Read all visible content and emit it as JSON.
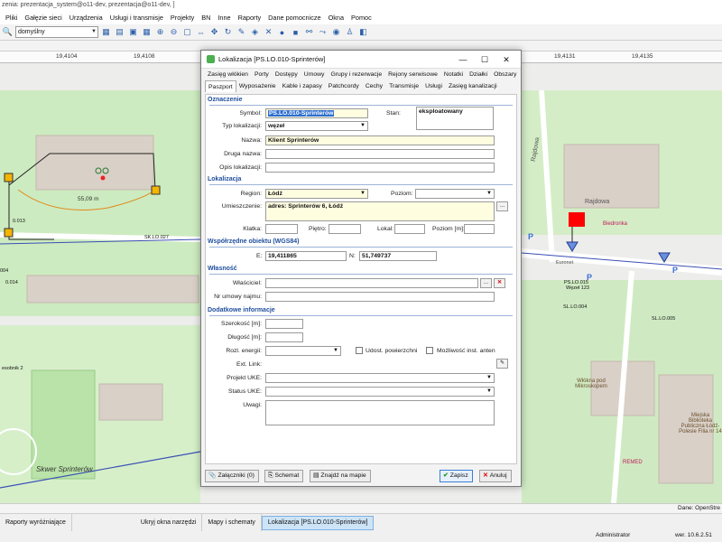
{
  "app": {
    "title": "zenia: prezentacja_system@o11-dev, prezentacja@o11-dev, ]",
    "menu": [
      "Pliki",
      "Gałęzie sieci",
      "Urządzenia",
      "Usługi i transmisje",
      "Projekty",
      "BN",
      "Inne",
      "Raporty",
      "Dane pomocnicze",
      "Okna",
      "Pomoc"
    ],
    "toolbar_combo": "domyślny"
  },
  "map": {
    "ruler_labels": [
      "19,4104",
      "19,4108",
      "19,4131",
      "19,4135"
    ],
    "labels": {
      "skwer": "Skwer Sprinterów",
      "street1": "Rajdowa",
      "street2": "Rajdowa",
      "biedronka": "Biedronka",
      "euronet": "Euronet",
      "wlokna": "Włókna pod Mikroskopem",
      "library": "Miejska Biblioteka Publiczna Łódź-Polesie Filia nr 14",
      "remed": "REMED",
      "distance": "55,09 m",
      "node_ps": "PS.LO.015",
      "node_wezel": "Węzeł 123",
      "node_sl1": "SL.LO.004",
      "node_sl2": "SL.LO.005",
      "node_sk": "SK.LO.027",
      "node_left1": "0.013",
      "node_left2": "004",
      "node_left3": "0.014",
      "left_pocz": "esobnik 2",
      "p": "P"
    }
  },
  "dialog": {
    "title": "Lokalizacja [PS.LO.010-Sprinterów]",
    "tabs_row1": [
      "Zasięg włókien",
      "Porty",
      "Dostępy",
      "Umowy",
      "Grupy i rezerwacje",
      "Rejony serwisowe",
      "Notatki",
      "Działki",
      "Obszary"
    ],
    "tabs_row2": [
      "Paszport",
      "Wyposażenie",
      "Kable i zapasy",
      "Patchcordy",
      "Cechy",
      "Transmisje",
      "Usługi",
      "Zasięg kanalizacji"
    ],
    "selected_tab": "Paszport",
    "sections": {
      "oznaczenie": "Oznaczenie",
      "lokalizacja": "Lokalizacja",
      "wspolrzedne": "Współrzędne obiektu (WGS84)",
      "wlasnosc": "Własność",
      "dodatkowe": "Dodatkowe informacje"
    },
    "fields": {
      "symbol_label": "Symbol:",
      "symbol_value": "PS.LO.010-Sprinterów",
      "stan_label": "Stan:",
      "stan_value": "eksploatowany",
      "typ_label": "Typ lokalizacji:",
      "typ_value": "węzeł",
      "nazwa_label": "Nazwa:",
      "nazwa_value": "Klient Sprinterów",
      "druga_label": "Druga nazwa:",
      "druga_value": "",
      "opis_label": "Opis lokalizacji:",
      "opis_value": "",
      "region_label": "Region:",
      "region_value": "Łódź",
      "poziom_label": "Poziom:",
      "poziom_value": "",
      "umiejsc_label": "Umieszczenie:",
      "umiejsc_value": "adres: Sprinterów 6, Łódź",
      "klatka_label": "Klatka:",
      "pietro_label": "Piętro:",
      "lokal_label": "Lokal:",
      "poziomm_label": "Poziom [m]:",
      "e_label": "E:",
      "e_value": "19,411865",
      "n_label": "N:",
      "n_value": "51,749737",
      "wlasciciel_label": "Właściciel:",
      "wlasciciel_value": "",
      "nr_umowy_label": "Nr umowy najmu:",
      "nr_umowy_value": "",
      "szer_label": "Szerokość [m]:",
      "dl_label": "Długość [m]:",
      "rozl_label": "Rozl. energii:",
      "udost_label": "Udost. powierzchni",
      "mozliw_label": "Możliwość inst. anten",
      "ext_label": "Ext. Link:",
      "projekt_label": "Projekt UKE:",
      "status_label": "Status UKE:",
      "uwagi_label": "Uwagi:"
    },
    "footer": {
      "zalaczniki": "Załączniki (0)",
      "schemat": "Schemat",
      "znajdz": "Znajdź na mapie",
      "zapisz": "Zapisz",
      "anuluj": "Anuluj"
    }
  },
  "statusbar": {
    "map_source": "Dane: OpenStre",
    "taskbar_items": [
      "Raporty wyróżniające",
      "Ukryj okna narzędzi",
      "Mapy i schematy",
      "Lokalizacja [PS.LO.010-Sprinterów]"
    ],
    "user": "Administrator",
    "version": "wer. 10.6.2.51"
  }
}
